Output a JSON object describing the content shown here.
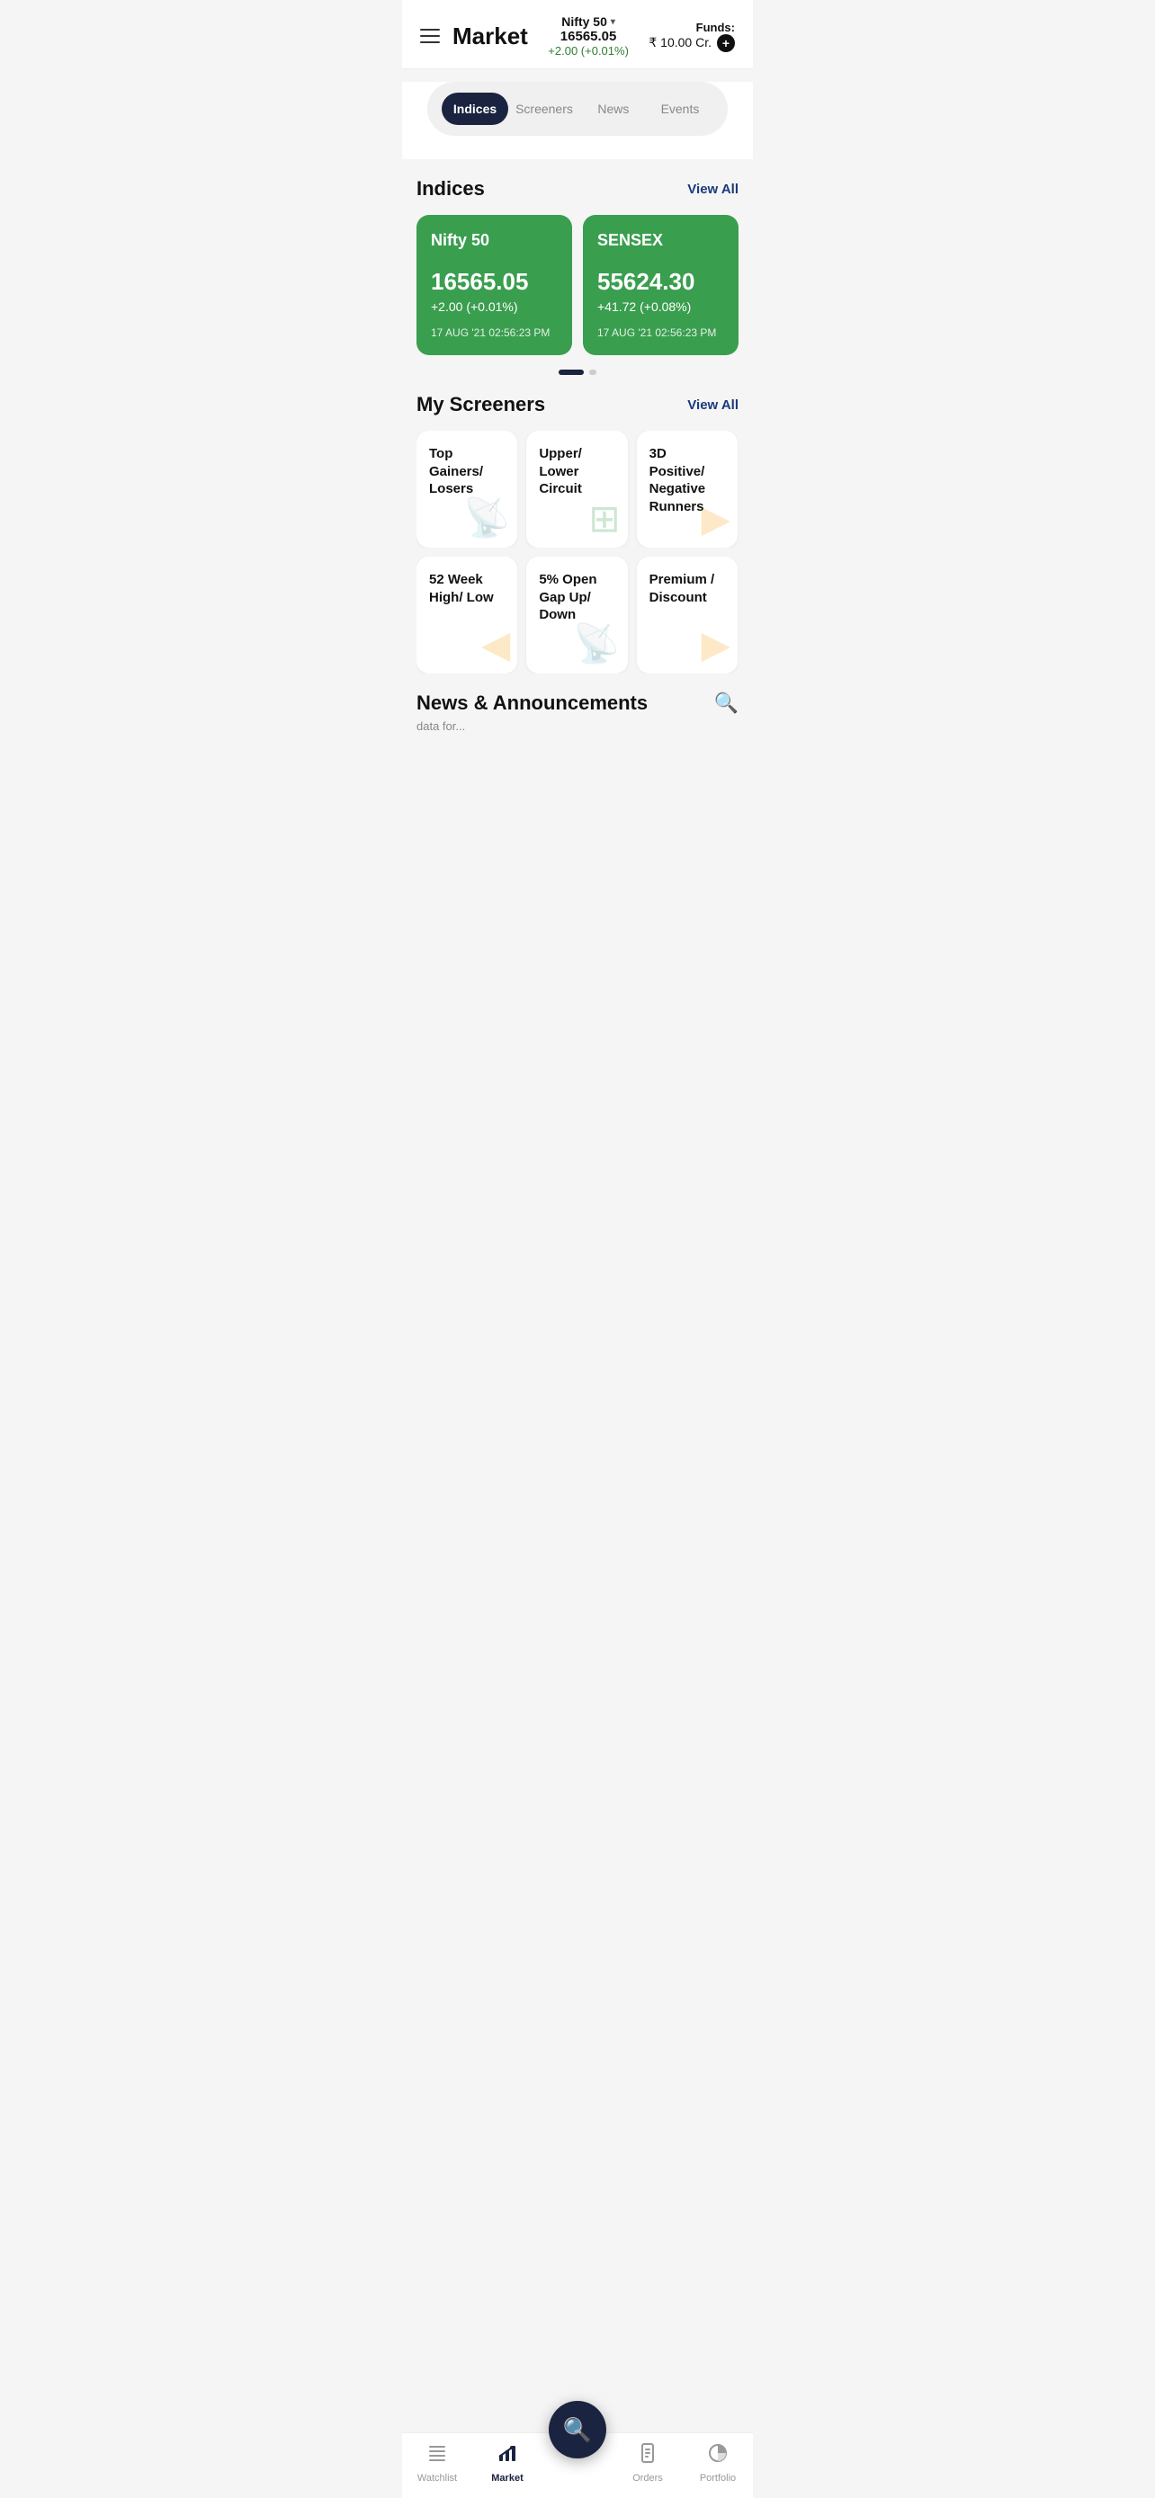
{
  "header": {
    "hamburger_label": "menu",
    "title": "Market",
    "nifty_label": "Nifty 50",
    "nifty_value": "16565.05",
    "nifty_change": "+2.00 (+0.01%)",
    "funds_label": "Funds:",
    "funds_value": "₹ 10.00 Cr.",
    "add_funds_label": "+"
  },
  "tabs": [
    {
      "id": "indices",
      "label": "Indices",
      "active": true
    },
    {
      "id": "screeners",
      "label": "Screeners",
      "active": false
    },
    {
      "id": "news",
      "label": "News",
      "active": false
    },
    {
      "id": "events",
      "label": "Events",
      "active": false
    }
  ],
  "indices": {
    "section_title": "Indices",
    "view_all": "View All",
    "cards": [
      {
        "name": "Nifty 50",
        "value": "16565.05",
        "change": "+2.00 (+0.01%)",
        "timestamp": "17 AUG '21 02:56:23 PM"
      },
      {
        "name": "SENSEX",
        "value": "55624.30",
        "change": "+41.72 (+0.08%)",
        "timestamp": "17 AUG '21 02:56:23 PM"
      }
    ]
  },
  "screeners": {
    "section_title": "My Screeners",
    "view_all": "View All",
    "cards_row1": [
      {
        "title": "Top Gainers/ Losers",
        "icon": "📡",
        "icon_class": "icon-orange"
      },
      {
        "title": "Upper/ Lower Circuit",
        "icon": "⊞",
        "icon_class": "icon-green"
      },
      {
        "title": "3D Positive/ Negative Runners",
        "icon": "▶",
        "icon_class": "icon-orange"
      }
    ],
    "cards_row2": [
      {
        "title": "52 Week High/ Low",
        "icon": "◀",
        "icon_class": "icon-orange"
      },
      {
        "title": "5% Open Gap Up/ Down",
        "icon": "📡",
        "icon_class": "icon-orange"
      },
      {
        "title": "Premium / Discount",
        "icon": "▶",
        "icon_class": "icon-orange"
      }
    ]
  },
  "news": {
    "section_title": "News & Announcements",
    "search_label": "🔍",
    "placeholder": "data for..."
  },
  "bottom_nav": {
    "items": [
      {
        "id": "watchlist",
        "label": "Watchlist",
        "active": false
      },
      {
        "id": "market",
        "label": "Market",
        "active": true
      },
      {
        "id": "search",
        "label": "",
        "active": false,
        "is_fab": true
      },
      {
        "id": "orders",
        "label": "Orders",
        "active": false
      },
      {
        "id": "portfolio",
        "label": "Portfolio",
        "active": false
      }
    ]
  }
}
